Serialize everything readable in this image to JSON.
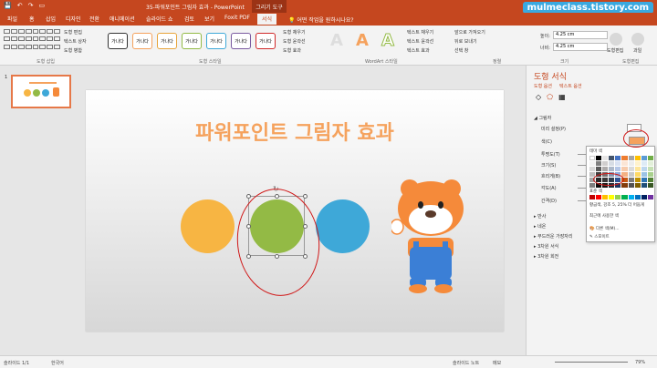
{
  "app": {
    "title": "35-파워포인트 그림자 효과 - PowerPoint",
    "tool_tab": "그리기 도구",
    "watermark": "mulmeclass.tistory.com"
  },
  "qa": {
    "save": "💾",
    "undo": "↶",
    "redo": "↷",
    "present": "▭"
  },
  "tabs": [
    {
      "label": "파일"
    },
    {
      "label": "홈"
    },
    {
      "label": "삽입"
    },
    {
      "label": "디자인"
    },
    {
      "label": "전환"
    },
    {
      "label": "애니메이션"
    },
    {
      "label": "슬라이드 쇼"
    },
    {
      "label": "검토"
    },
    {
      "label": "보기"
    },
    {
      "label": "Foxit PDF"
    },
    {
      "label": "서식"
    }
  ],
  "help": "어떤 작업을 원하시나요?",
  "ribbon": {
    "insert_shapes_label": "도형 삽입",
    "edit_shape": "도형 편집",
    "text_box": "텍스트 상자",
    "merge_shapes": "도형 병합",
    "shape_styles_label": "도형 스타일",
    "style_text": "가나다",
    "shape_fill": "도형 채우기",
    "shape_outline": "도형 윤곽선",
    "shape_effects": "도형 효과",
    "wordart_label": "WordArt 스타일",
    "wordart_glyph": "A",
    "text_fill": "텍스트 채우기",
    "text_outline": "텍스트 윤곽선",
    "text_effects": "텍스트 효과",
    "bring_forward": "앞으로 가져오기",
    "send_backward": "뒤로 보내기",
    "selection_pane": "선택 창",
    "arrange_label": "정렬",
    "height_label": "높이:",
    "height_value": "4.25 cm",
    "width_label": "너비:",
    "width_value": "4.25 cm",
    "size_label": "크기",
    "shape_edit_label": "도형편집",
    "fruit_label": "과일",
    "shape_edit_btn": "도형편집"
  },
  "slides_pane": {
    "slide_number": "1"
  },
  "slide": {
    "title": "파워포인트 그림자 효과",
    "colors": {
      "orange": "#f7b543",
      "green": "#93ba45",
      "blue": "#3ea8d8",
      "title": "#f5a25d"
    }
  },
  "format_pane": {
    "title": "도형 서식",
    "tab_shape": "도형 옵션",
    "tab_text": "텍스트 옵션",
    "section_shadow": "그림자",
    "preset": "미리 설정(P)",
    "color": "색(C)",
    "transparency": "투명도(T)",
    "size": "크기(S)",
    "blur": "흐리게(B)",
    "angle": "각도(A)",
    "distance": "간격(D)",
    "reflection": "반사",
    "glow": "네온",
    "soft_edges": "부드러운 가장자리",
    "three_d_format": "3차원 서식",
    "three_d_rotation": "3차원 회전"
  },
  "color_popup": {
    "theme_colors": "테마 색",
    "standard_colors": "표준 색",
    "tooltip": "황금색, 강조 5, 25% 더 어둡게",
    "recent_colors": "최근에 사용한 색",
    "more_colors": "다른 색(M)...",
    "eyedropper": "스포이트"
  },
  "status": {
    "slide_info": "슬라이드 1/1",
    "language": "한국어",
    "notes": "슬라이드 노트",
    "comments": "메모",
    "zoom": "79%"
  }
}
